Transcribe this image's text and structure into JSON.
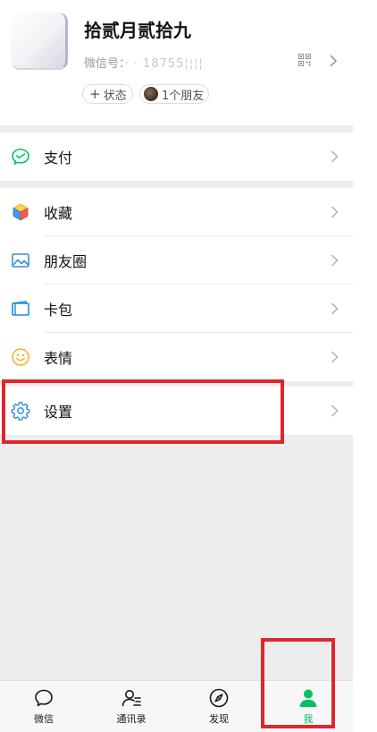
{
  "profile": {
    "nickname": "拾贰月贰拾九",
    "wxid_label": "微信号：",
    "wxid_value": "· · 18755¦¦¦¦",
    "status_button": "状态",
    "friends_button": "1个朋友"
  },
  "menu": {
    "pay": "支付",
    "favorites": "收藏",
    "moments": "朋友圈",
    "cards": "卡包",
    "stickers": "表情",
    "settings": "设置"
  },
  "tabbar": {
    "chats": "微信",
    "contacts": "通讯录",
    "discover": "发现",
    "me": "我"
  },
  "colors": {
    "accent": "#07c160",
    "annotation": "#e0262a",
    "background": "#ededed"
  },
  "icons": [
    "pay-icon",
    "favorites-cube-icon",
    "moments-picture-icon",
    "card-wallet-icon",
    "sticker-smile-icon",
    "settings-gear-icon",
    "qr-code-icon",
    "chevron-right-icon",
    "chat-bubble-icon",
    "contacts-icon",
    "compass-icon",
    "person-icon"
  ]
}
